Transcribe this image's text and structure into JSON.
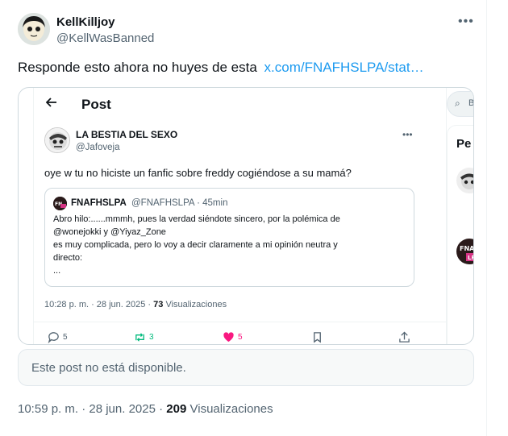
{
  "author": {
    "name": "KellKilljoy",
    "handle": "@KellWasBanned"
  },
  "tweet": {
    "text": "Responde esto ahora no huyes de esta",
    "link": "x.com/FNAFHSLPA/stat…"
  },
  "embedded": {
    "header_title": "Post",
    "author": {
      "name": "LA BESTIA DEL SEXO",
      "handle": "@Jafoveja"
    },
    "text": "oye w tu no hiciste un fanfic sobre freddy cogiéndose a su mamá?",
    "quote": {
      "name": "FNAFHSLPA",
      "meta": "@FNAFHSLPA · 45min",
      "lines": [
        "Abro hilo:......mmmh, pues la verdad siéndote sincero, por la polémica de",
        "@wonejokki y @Yiyaz_Zone",
        "es muy complicada, pero lo voy a decir claramente a mi opinión neutra y",
        "directo:",
        "..."
      ]
    },
    "timestamp": "10:28 p. m. · 28 jun. 2025 ·",
    "views_count": "73",
    "views_label": "Visualizaciones",
    "actions": {
      "replies": "5",
      "reposts": "3",
      "likes": "5"
    },
    "colors": {
      "repost": "#00ba7c",
      "like": "#f91880"
    },
    "sidebar": {
      "search_text": "B",
      "panel_title": "Pe"
    }
  },
  "unavailable_text": "Este post no está disponible.",
  "timestamp": "10:59 p. m. · 28 jun. 2025 ·",
  "views_count": "209",
  "views_label": "Visualizaciones"
}
